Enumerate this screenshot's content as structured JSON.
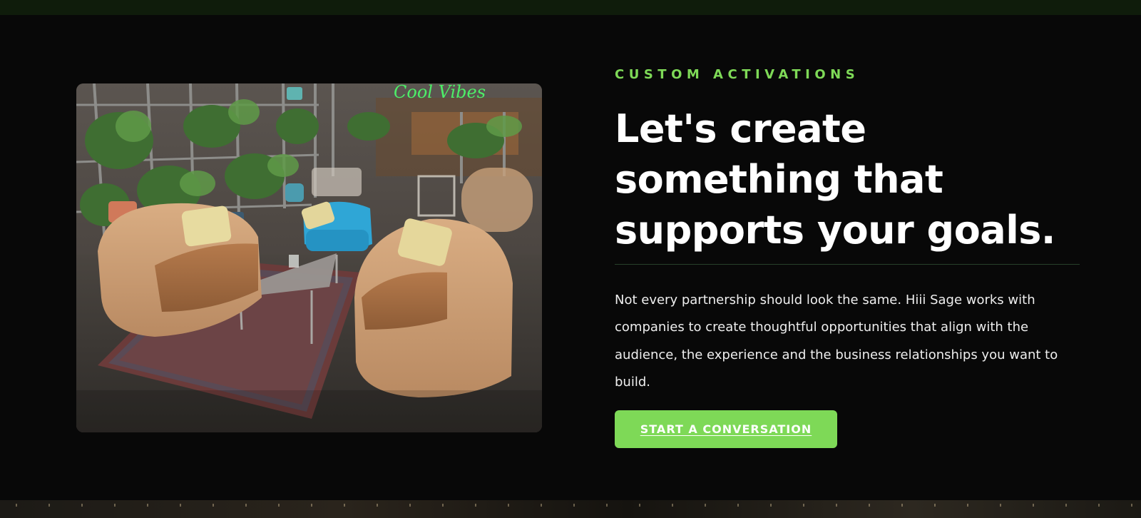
{
  "section": {
    "eyebrow": "CUSTOM ACTIVATIONS",
    "headline": "Let's create something that supports your goals.",
    "body": "Not every partnership should look the same. Hiii Sage works with companies to create thoughtful opportunities that align with the audience, the experience and the business relationships you want to build.",
    "cta_label": "START A CONVERSATION"
  },
  "photo": {
    "neon_sign": "Cool Vibes"
  },
  "colors": {
    "accent": "#7ed957",
    "background": "#080808",
    "top_strip": "#0f1c0b",
    "text": "#ffffff"
  }
}
